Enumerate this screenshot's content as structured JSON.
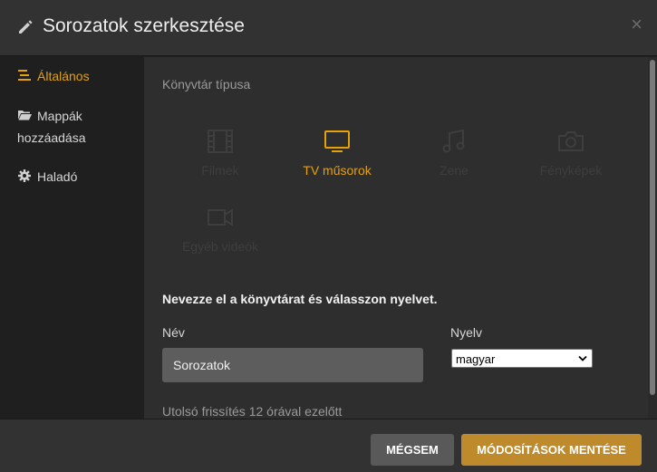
{
  "header": {
    "title": "Sorozatok szerkesztése",
    "close_label": "×"
  },
  "sidebar": {
    "items": [
      {
        "label": "Általános",
        "icon": "list-icon",
        "active": true
      },
      {
        "label": "Mappák hozzáadása",
        "icon": "folder-icon",
        "active": false
      },
      {
        "label": "Haladó",
        "icon": "gear-icon",
        "active": false
      }
    ]
  },
  "main": {
    "section_label": "Könyvtár típusa",
    "types": [
      {
        "label": "Filmek",
        "icon": "film-icon",
        "selected": false
      },
      {
        "label": "TV műsorok",
        "icon": "tv-icon",
        "selected": true
      },
      {
        "label": "Zene",
        "icon": "music-icon",
        "selected": false
      },
      {
        "label": "Fényképek",
        "icon": "camera-icon",
        "selected": false
      },
      {
        "label": "Egyéb videók",
        "icon": "video-camera-icon",
        "selected": false
      }
    ],
    "prompt": "Nevezze el a könyvtárat és válasszon nyelvet.",
    "name_label": "Név",
    "name_value": "Sorozatok",
    "language_label": "Nyelv",
    "language_value": "magyar",
    "last_updated": "Utolsó frissítés 12 órával ezelőtt"
  },
  "footer": {
    "cancel_label": "Mégsem",
    "save_label": "Módosítások mentése"
  },
  "colors": {
    "accent": "#e5a00d",
    "save_button": "#bf8a2b",
    "cancel_button": "#595959",
    "panel": "#2e2e2e",
    "sidebar": "#1f1f1f"
  }
}
